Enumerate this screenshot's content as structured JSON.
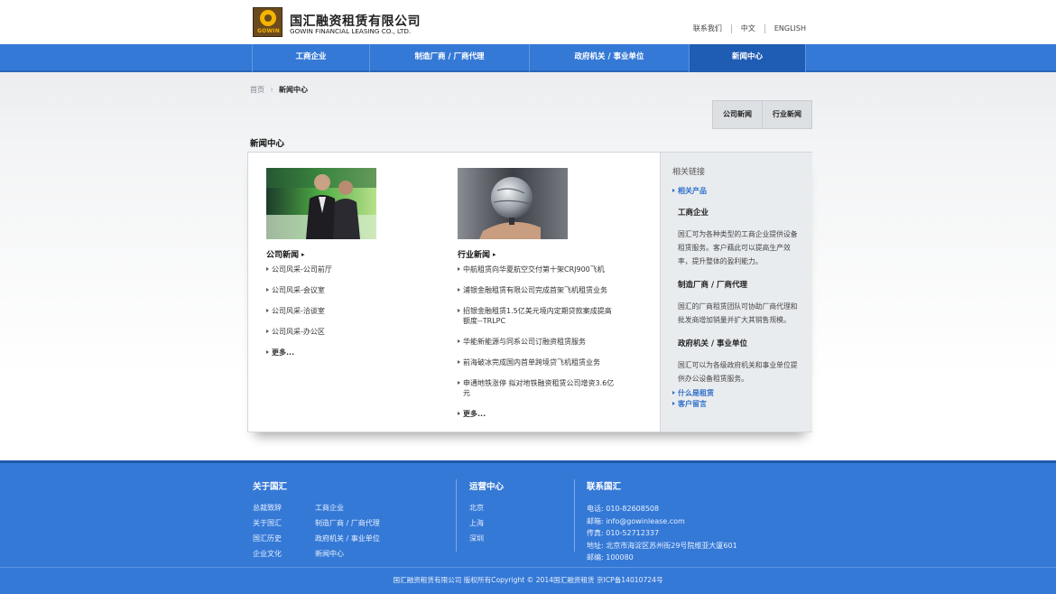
{
  "header": {
    "logo_text": "GOWIN",
    "brand_cn": "国汇融资租赁有限公司",
    "brand_en": "GOWIN FINANCIAL LEASING CO., LTD.",
    "top_links": [
      "联系我们",
      "中文",
      "ENGLISH"
    ]
  },
  "nav": {
    "items": [
      {
        "label": "工商企业"
      },
      {
        "label": "制造厂商 / 厂商代理"
      },
      {
        "label": "政府机关 / 事业单位"
      },
      {
        "label": "新闻中心"
      }
    ],
    "active_index": 3
  },
  "breadcrumb": {
    "home": "首页",
    "current": "新闻中心"
  },
  "subtabs": [
    "公司新闻",
    "行业新闻"
  ],
  "page_title": "新闻中心",
  "company_news": {
    "heading": "公司新闻",
    "items": [
      "公司风采-公司前厅",
      "公司风采-会议室",
      "公司风采-洽谈室",
      "公司风采-办公区"
    ],
    "more": "更多..."
  },
  "industry_news": {
    "heading": "行业新闻",
    "items": [
      "中航租赁向华夏航空交付第十架CRJ900飞机",
      "浦银金融租赁有限公司完成首架飞机租赁业务",
      "招银金融租赁1.5亿美元境内定期贷款案成提高额度--TRLPC",
      "华能新能源与同系公司订融资租赁服务",
      "前海破冰完成国内首单跨境贷飞机租赁业务",
      "申通地铁涨停 拟对地铁融资租赁公司增资3.6亿元"
    ],
    "more": "更多..."
  },
  "sidebar": {
    "title": "相关链接",
    "link_products": "相关产品",
    "sections": [
      {
        "heading": "工商企业",
        "text": "国汇可为各种类型的工商企业提供设备租赁服务。客户藉此可以提高生产效率，提升整体的盈利能力。"
      },
      {
        "heading": "制造厂商 / 厂商代理",
        "text": "国汇的厂商租赁团队可协助厂商代理和批发商增加销量并扩大其销售规模。"
      },
      {
        "heading": "政府机关 / 事业单位",
        "text": "国汇可以为各级政府机关和事业单位提供办公设备租赁服务。"
      }
    ],
    "link_leasing": "什么是租赁",
    "link_message": "客户留言"
  },
  "footer": {
    "about": {
      "heading": "关于国汇",
      "links": [
        "总裁致辞",
        "工商企业",
        "关于国汇",
        "制造厂商 / 厂商代理",
        "国汇历史",
        "政府机关 / 事业单位",
        "企业文化",
        "新闻中心"
      ]
    },
    "ops": {
      "heading": "运营中心",
      "cities": [
        "北京",
        "上海",
        "深圳"
      ]
    },
    "contact": {
      "heading": "联系国汇",
      "lines": [
        "电话: 010-82608508",
        "邮箱: info@gowinlease.com",
        "传真: 010-52712337",
        "地址: 北京市海淀区苏州街29号院维亚大厦601",
        "邮编: 100080"
      ]
    },
    "copyright": "国汇融资租赁有限公司 版权所有Copyright © 2014国汇融资租赁  京ICP备14010724号"
  },
  "colors": {
    "nav_blue": "#3579d6",
    "nav_active": "#1f5cb3",
    "link_blue": "#2e6fca",
    "logo_brown": "#6b4a1e",
    "logo_gold": "#f4b400"
  }
}
